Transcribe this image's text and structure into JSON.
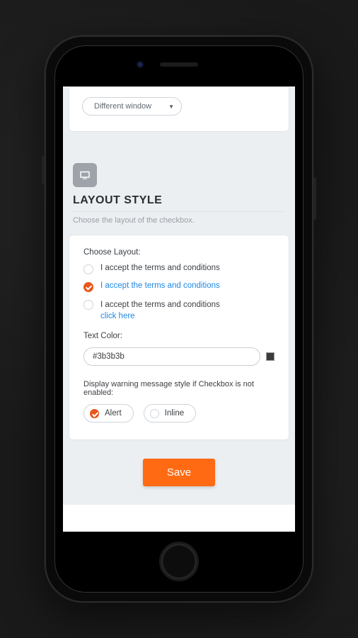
{
  "top_select": {
    "value": "Different window"
  },
  "section": {
    "title": "LAYOUT STYLE",
    "subtitle": "Choose the layout of the checkbox."
  },
  "layout": {
    "choose_label": "Choose Layout:",
    "options": [
      {
        "text": "I accept the terms and conditions",
        "selected": false
      },
      {
        "text": "I accept the terms and conditions",
        "selected": true
      },
      {
        "text_line1": "I accept the terms and conditions",
        "text_line2": "click here",
        "selected": false
      }
    ],
    "text_color_label": "Text Color:",
    "text_color_value": "#3b3b3b",
    "warning_label": "Display warning message style if Checkbox is not enabled:",
    "warning_options": [
      {
        "label": "Alert",
        "selected": true
      },
      {
        "label": "Inline",
        "selected": false
      }
    ]
  },
  "save_label": "Save"
}
